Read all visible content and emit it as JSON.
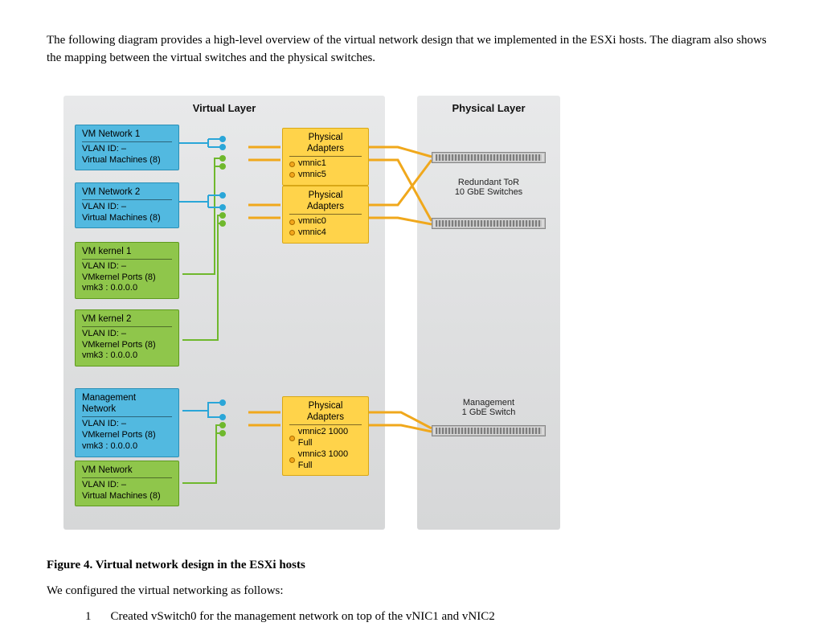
{
  "intro": "The following diagram provides a high-level overview of the virtual network design that we implemented in the ESXi hosts. The diagram also shows the mapping between the virtual switches and the physical switches.",
  "caption_prefix": "Figure 4. ",
  "caption": "Virtual network design in the ESXi hosts",
  "after": "We configured the virtual networking as follows:",
  "cutoff_num": "1",
  "cutoff_text": "Created vSwitch0 for the management network on top of the vNIC1 and vNIC2",
  "virtual_layer_title": "Virtual Layer",
  "physical_layer_title": "Physical Layer",
  "left_boxes": {
    "vmnet1": {
      "title": "VM Network 1",
      "l1": "VLAN ID: –",
      "l2": "Virtual Machines (8)"
    },
    "vmnet2": {
      "title": "VM Network 2",
      "l1": "VLAN ID: –",
      "l2": "Virtual Machines (8)"
    },
    "vmk1": {
      "title": "VM kernel 1",
      "l1": "VLAN ID: –",
      "l2": "VMkernel Ports (8)",
      "l3": "vmk3 : 0.0.0.0"
    },
    "vmk2": {
      "title": "VM kernel 2",
      "l1": "VLAN ID: –",
      "l2": "VMkernel Ports (8)",
      "l3": "vmk3 : 0.0.0.0"
    },
    "mgmt": {
      "title": "Management Network",
      "l1": "VLAN ID: –",
      "l2": "VMkernel Ports (8)",
      "l3": "vmk3 : 0.0.0.0"
    },
    "vmnet": {
      "title": "VM Network",
      "l1": "VLAN ID: –",
      "l2": "Virtual Machines (8)"
    }
  },
  "adapters": {
    "top": {
      "title": "Physical Adapters",
      "n1": "vmnic1",
      "n2": "vmnic5"
    },
    "mid": {
      "title": "Physical Adapters",
      "n1": "vmnic0",
      "n2": "vmnic4"
    },
    "bot": {
      "title": "Physical Adapters",
      "n1": "vmnic2 1000 Full",
      "n2": "vmnic3 1000 Full"
    }
  },
  "phys": {
    "tor_l1": "Redundant ToR",
    "tor_l2": "10 GbE Switches",
    "mgmt_l1": "Management",
    "mgmt_l2": "1 GbE Switch"
  }
}
